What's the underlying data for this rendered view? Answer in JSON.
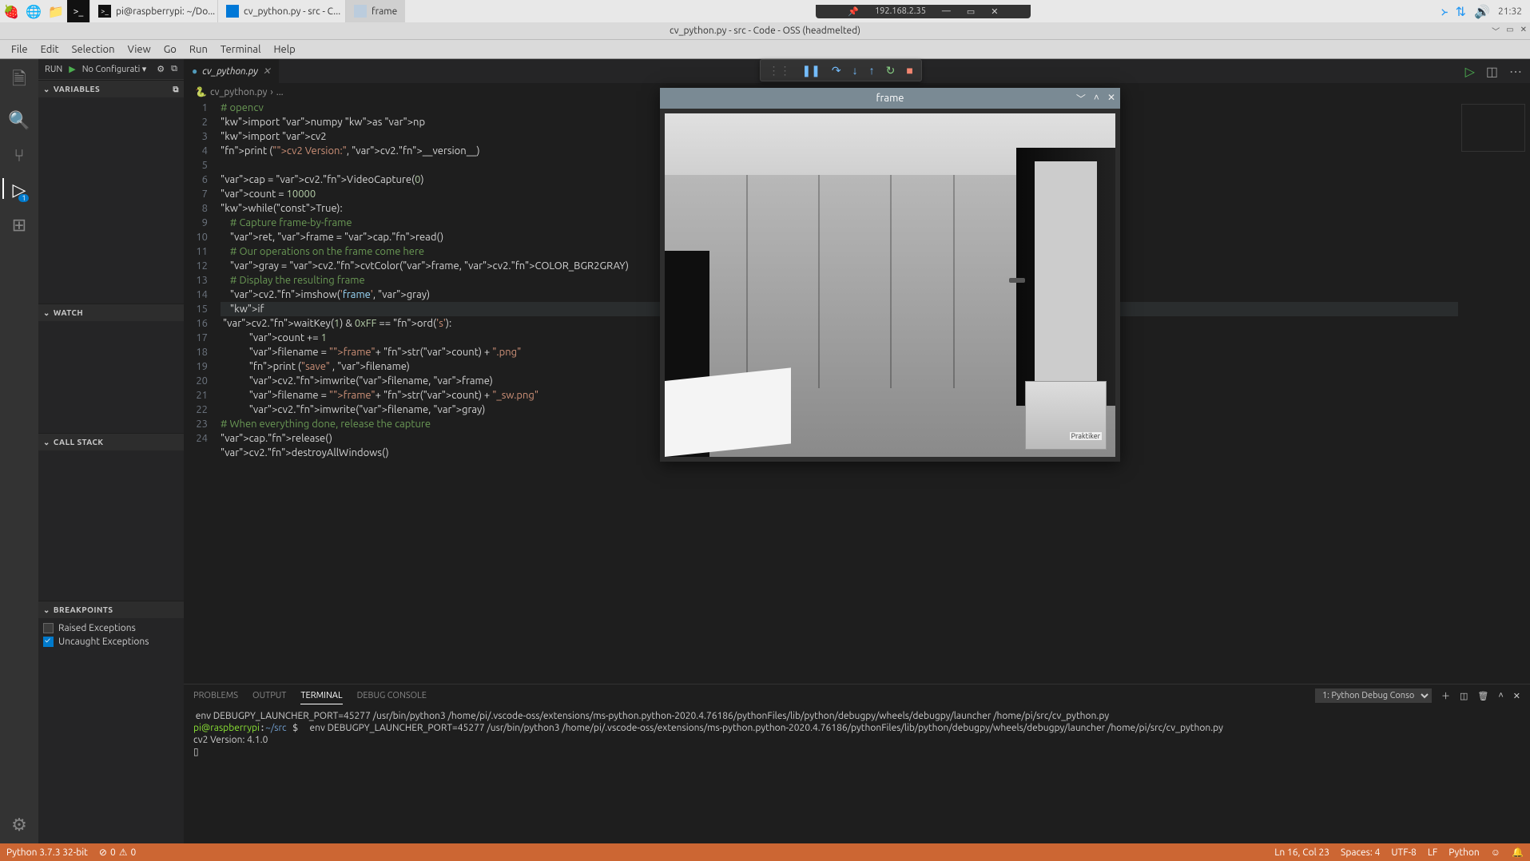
{
  "taskbar": {
    "items": [
      {
        "label": "pi@raspberrypi: ~/Do..."
      },
      {
        "label": "cv_python.py - src - C..."
      },
      {
        "label": "frame"
      }
    ],
    "vnc_host": "192.168.2.35",
    "time": "21:32"
  },
  "titlebar": {
    "title": "cv_python.py - src - Code - OSS (headmelted)"
  },
  "menubar": [
    "File",
    "Edit",
    "Selection",
    "View",
    "Go",
    "Run",
    "Terminal",
    "Help"
  ],
  "activity": {
    "debug_badge": "1"
  },
  "sidebar": {
    "run_label": "RUN",
    "config": "No Configurati",
    "sections": {
      "variables": "VARIABLES",
      "watch": "WATCH",
      "callstack": "CALL STACK",
      "breakpoints": "BREAKPOINTS"
    },
    "bp": {
      "raised": "Raised Exceptions",
      "uncaught": "Uncaught Exceptions"
    }
  },
  "tab": {
    "name": "cv_python.py"
  },
  "breadcrumb": {
    "file": "cv_python.py",
    "more": "..."
  },
  "terminal": {
    "tabs": [
      "PROBLEMS",
      "OUTPUT",
      "TERMINAL",
      "DEBUG CONSOLE"
    ],
    "selector": "1: Python Debug Conso",
    "line1": " env DEBUGPY_LAUNCHER_PORT=45277 /usr/bin/python3 /home/pi/.vscode-oss/extensions/ms-python.python-2020.4.76186/pythonFiles/lib/python/debugpy/wheels/debugpy/launcher /home/pi/src/cv_python.py",
    "prompt_user": "pi@raspberrypi",
    "prompt_path": "~/src",
    "line2_cmd": "env DEBUGPY_LAUNCHER_PORT=45277 /usr/bin/python3 /home/pi/.vscode-oss/extensions/ms-python.python-2020.4.76186/pythonFiles/lib/python/debugpy/wheels/debugpy/launcher /home/pi/src/cv_python.py",
    "out1": "cv2 Version: 4.1.0",
    "out2": "▯"
  },
  "statusbar": {
    "python": "Python 3.7.3 32-bit",
    "errors": "0",
    "warnings": "0",
    "lncol": "Ln 16, Col 23",
    "spaces": "Spaces: 4",
    "encoding": "UTF-8",
    "eol": "LF",
    "lang": "Python"
  },
  "cvframe": {
    "title": "frame",
    "box_label": "Praktiker"
  },
  "code": {
    "lines": [
      "# opencv",
      "import numpy as np",
      "import cv2",
      "print (\"cv2 Version:\", cv2.__version__)",
      "",
      "cap = cv2.VideoCapture(0)",
      "count = 10000",
      "while(True):",
      "    # Capture frame-by-frame",
      "    ret, frame = cap.read()",
      "    # Our operations on the frame come here",
      "    gray = cv2.cvtColor(frame, cv2.COLOR_BGR2GRAY)",
      "    # Display the resulting frame",
      "    cv2.imshow('frame', gray)",
      "    if cv2.waitKey(1) & 0xFF == ord('s'):",
      "            count += 1",
      "            filename = \"frame\"+ str(count) + \".png\"",
      "            print (\"save\" , filename)",
      "            cv2.imwrite(filename, frame)",
      "            filename = \"frame\"+ str(count) + \"_sw.png\"",
      "            cv2.imwrite(filename, gray)",
      "# When everything done, release the capture",
      "cap.release()",
      "cv2.destroyAllWindows()"
    ]
  }
}
